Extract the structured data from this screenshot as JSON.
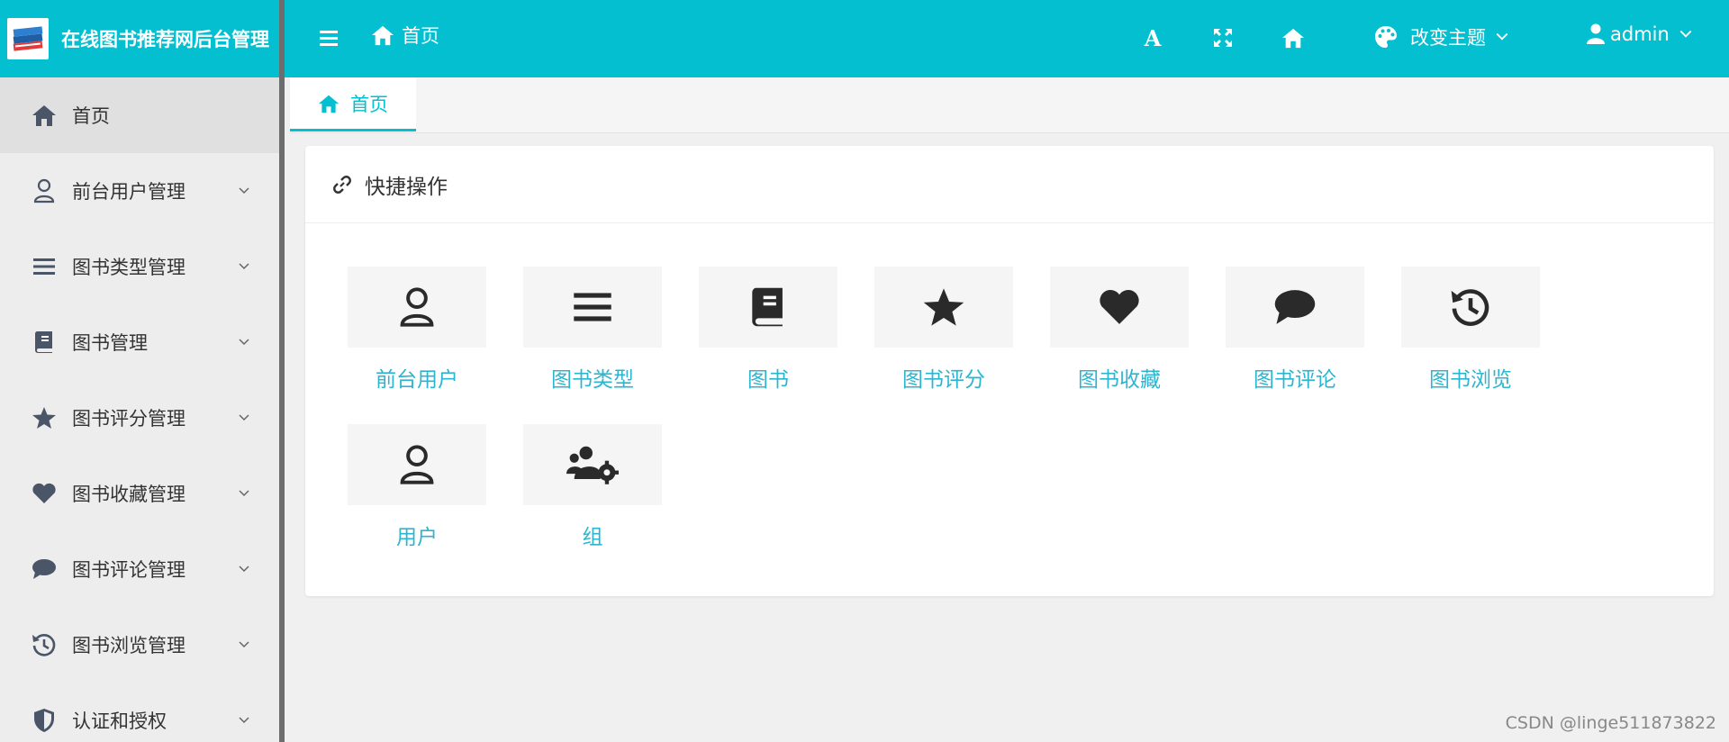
{
  "app": {
    "title": "在线图书推荐网后台管理"
  },
  "sidebar": {
    "items": [
      {
        "label": "首页",
        "icon": "home-icon",
        "active": true,
        "expandable": false
      },
      {
        "label": "前台用户管理",
        "icon": "user-icon",
        "expandable": true
      },
      {
        "label": "图书类型管理",
        "icon": "list-icon",
        "expandable": true
      },
      {
        "label": "图书管理",
        "icon": "book-icon",
        "expandable": true
      },
      {
        "label": "图书评分管理",
        "icon": "star-icon",
        "expandable": true
      },
      {
        "label": "图书收藏管理",
        "icon": "heart-icon",
        "expandable": true
      },
      {
        "label": "图书评论管理",
        "icon": "comment-icon",
        "expandable": true
      },
      {
        "label": "图书浏览管理",
        "icon": "history-icon",
        "expandable": true
      },
      {
        "label": "认证和授权",
        "icon": "shield-icon",
        "expandable": true
      }
    ]
  },
  "header": {
    "breadcrumb": "首页",
    "theme_label": "改变主题",
    "user_label": "admin",
    "font_icon_letter": "A"
  },
  "tabs": [
    {
      "label": "首页"
    }
  ],
  "quick": {
    "title": "快捷操作",
    "tiles": [
      {
        "label": "前台用户",
        "icon": "user-icon"
      },
      {
        "label": "图书类型",
        "icon": "list-icon"
      },
      {
        "label": "图书",
        "icon": "book-icon"
      },
      {
        "label": "图书评分",
        "icon": "star-icon"
      },
      {
        "label": "图书收藏",
        "icon": "heart-icon"
      },
      {
        "label": "图书评论",
        "icon": "comment-icon"
      },
      {
        "label": "图书浏览",
        "icon": "history-icon"
      },
      {
        "label": "用户",
        "icon": "user-icon"
      },
      {
        "label": "组",
        "icon": "users-cog-icon"
      }
    ]
  },
  "watermark": "CSDN @linge511873822",
  "colors": {
    "accent": "#03bfcf",
    "link": "#2bb5d0",
    "sidebar_bg": "#ededed"
  }
}
